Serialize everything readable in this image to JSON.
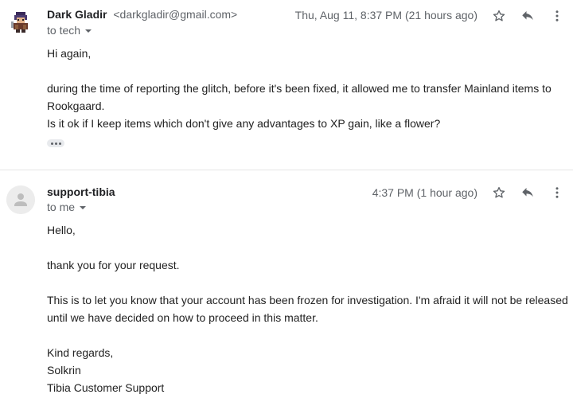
{
  "messages": [
    {
      "sender_name": "Dark Gladir",
      "sender_email": "<darkgladir@gmail.com>",
      "recipient": "to tech",
      "timestamp": "Thu, Aug 11, 8:37 PM (21 hours ago)",
      "body": [
        "Hi again,",
        "during the time of reporting the glitch, before it's been fixed, it allowed me to transfer Mainland items to Rookgaard.\nIs it ok if I keep items which don't give any advantages to XP gain, like a flower?"
      ],
      "avatar_icon": "pixel-character-avatar"
    },
    {
      "sender_name": "support-tibia",
      "recipient": "to me",
      "timestamp": "4:37 PM (1 hour ago)",
      "body": [
        "Hello,",
        "thank you for your request.",
        "This is to let you know that your account has been frozen for investigation. I'm afraid it will not be released until we have decided on how to proceed in this matter.",
        "Kind regards,\nSolkrin\nTibia Customer Support"
      ],
      "avatar_icon": "default-person-avatar"
    }
  ],
  "icons": {
    "star": "star-icon",
    "reply": "reply-icon",
    "more": "more-vert-icon",
    "expand": "show-trimmed-content-icon"
  },
  "colors": {
    "text": "#222222",
    "secondary": "#5f6368",
    "divider": "#e6e6e6"
  }
}
